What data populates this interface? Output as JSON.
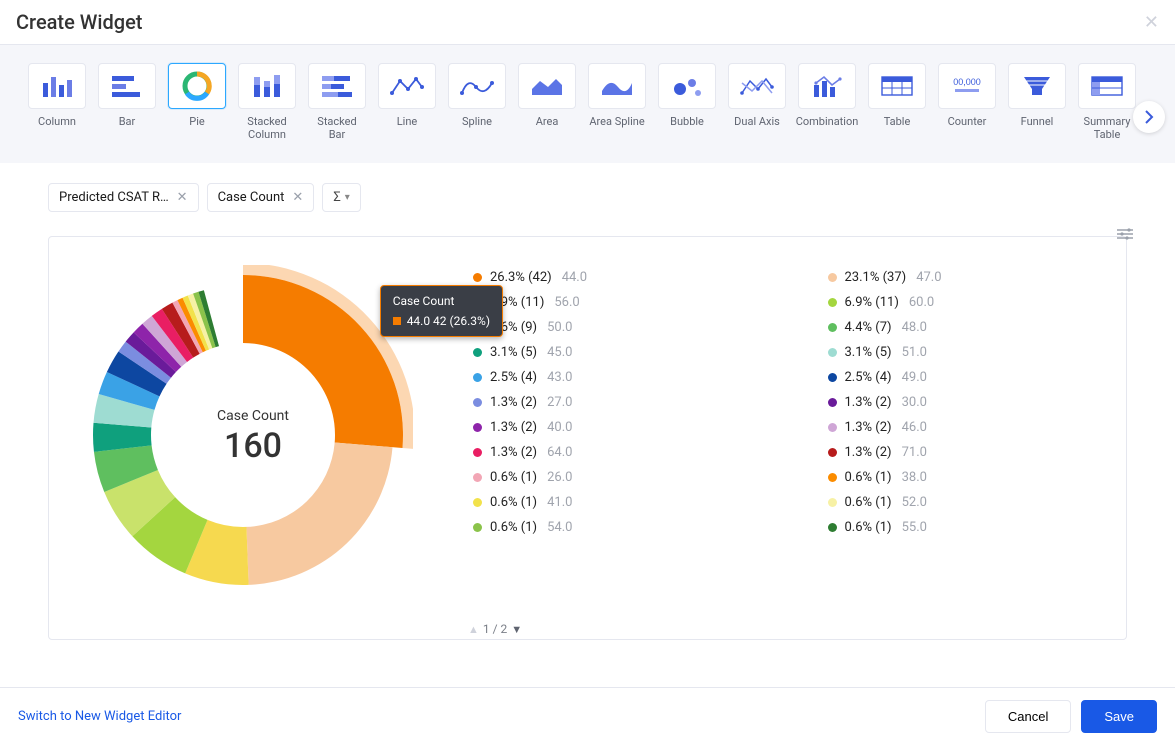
{
  "header": {
    "title": "Create Widget"
  },
  "chart_types": [
    {
      "key": "column",
      "label": "Column"
    },
    {
      "key": "bar",
      "label": "Bar"
    },
    {
      "key": "pie",
      "label": "Pie",
      "selected": true
    },
    {
      "key": "stacked-column",
      "label": "Stacked Column"
    },
    {
      "key": "stacked-bar",
      "label": "Stacked Bar"
    },
    {
      "key": "line",
      "label": "Line"
    },
    {
      "key": "spline",
      "label": "Spline"
    },
    {
      "key": "area",
      "label": "Area"
    },
    {
      "key": "area-spline",
      "label": "Area Spline"
    },
    {
      "key": "bubble",
      "label": "Bubble"
    },
    {
      "key": "dual-axis",
      "label": "Dual Axis"
    },
    {
      "key": "combination",
      "label": "Combination"
    },
    {
      "key": "table",
      "label": "Table"
    },
    {
      "key": "counter",
      "label": "Counter"
    },
    {
      "key": "funnel",
      "label": "Funnel"
    },
    {
      "key": "summary-table",
      "label": "Summary Table"
    }
  ],
  "pills": [
    {
      "label": "Predicted CSAT R…"
    },
    {
      "label": "Case Count"
    }
  ],
  "sigma": "Σ",
  "chart_center": {
    "title": "Case Count",
    "value": "160"
  },
  "tooltip": {
    "title": "Case Count",
    "line": "44.0  42 (26.3%)"
  },
  "pager": {
    "text": "1 / 2"
  },
  "footer": {
    "switch": "Switch to New Widget Editor",
    "cancel": "Cancel",
    "save": "Save"
  },
  "chart_data": {
    "type": "pie",
    "title": "Case Count",
    "total": 160,
    "value_label": "Case Count",
    "tooltip_segment": {
      "category": "44.0",
      "count": 42,
      "percent": 26.3
    },
    "segments": [
      {
        "percent": 26.3,
        "count": 42,
        "category": "44.0",
        "color": "#f57c00"
      },
      {
        "percent": 23.1,
        "count": 37,
        "category": "47.0",
        "color": "#f7c9a0"
      },
      {
        "percent": 6.9,
        "count": 11,
        "category": "56.0",
        "color": "#f6d94f"
      },
      {
        "percent": 6.9,
        "count": 11,
        "category": "60.0",
        "color": "#a4d63f"
      },
      {
        "percent": 5.6,
        "count": 9,
        "category": "50.0",
        "color": "#c9e26b"
      },
      {
        "percent": 4.4,
        "count": 7,
        "category": "48.0",
        "color": "#5fbf5f"
      },
      {
        "percent": 3.1,
        "count": 5,
        "category": "45.0",
        "color": "#0fa07d"
      },
      {
        "percent": 3.1,
        "count": 5,
        "category": "51.0",
        "color": "#9edcd2"
      },
      {
        "percent": 2.5,
        "count": 4,
        "category": "43.0",
        "color": "#3aa2e6"
      },
      {
        "percent": 2.5,
        "count": 4,
        "category": "49.0",
        "color": "#0d47a1"
      },
      {
        "percent": 1.3,
        "count": 2,
        "category": "27.0",
        "color": "#7b8de0"
      },
      {
        "percent": 1.3,
        "count": 2,
        "category": "30.0",
        "color": "#6a1b9a"
      },
      {
        "percent": 1.3,
        "count": 2,
        "category": "40.0",
        "color": "#8e24aa"
      },
      {
        "percent": 1.3,
        "count": 2,
        "category": "46.0",
        "color": "#cfa6d6"
      },
      {
        "percent": 1.3,
        "count": 2,
        "category": "64.0",
        "color": "#e91e63"
      },
      {
        "percent": 1.3,
        "count": 2,
        "category": "71.0",
        "color": "#b71c1c"
      },
      {
        "percent": 0.6,
        "count": 1,
        "category": "26.0",
        "color": "#f2a6b5"
      },
      {
        "percent": 0.6,
        "count": 1,
        "category": "38.0",
        "color": "#fb8c00"
      },
      {
        "percent": 0.6,
        "count": 1,
        "category": "41.0",
        "color": "#f2e24b"
      },
      {
        "percent": 0.6,
        "count": 1,
        "category": "52.0",
        "color": "#f7f1a5"
      },
      {
        "percent": 0.6,
        "count": 1,
        "category": "54.0",
        "color": "#8bc34a"
      },
      {
        "percent": 0.6,
        "count": 1,
        "category": "55.0",
        "color": "#2e7d32"
      }
    ],
    "legend_order": [
      "44.0",
      "47.0",
      "56.0",
      "60.0",
      "50.0",
      "48.0",
      "45.0",
      "51.0",
      "43.0",
      "49.0",
      "27.0",
      "30.0",
      "40.0",
      "46.0",
      "64.0",
      "71.0",
      "26.0",
      "38.0",
      "41.0",
      "52.0",
      "54.0",
      "55.0"
    ]
  }
}
